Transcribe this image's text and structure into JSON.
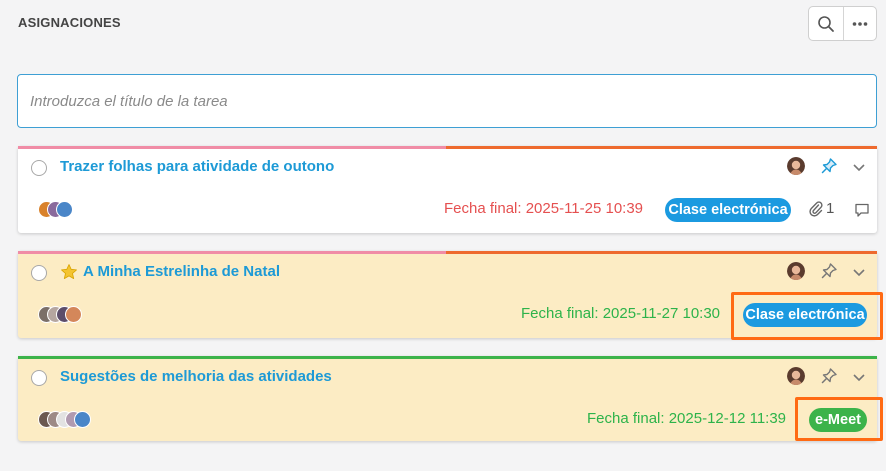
{
  "header": {
    "title": "ASIGNACIONES",
    "search_icon": "search-icon",
    "more_icon": "more-horizontal-icon"
  },
  "task_input": {
    "placeholder": "Introduzca el título de la tarea",
    "value": ""
  },
  "colors": {
    "link_blue": "#1d9ad6",
    "due_red": "#e55050",
    "due_green": "#2db34a",
    "badge_blue": "#1b9ae0",
    "badge_green": "#3cb34a",
    "card_yellow": "#fcecc4",
    "highlight_orange": "#ff6a13"
  },
  "tasks": [
    {
      "title": "Trazer folhas para atividade de outono",
      "due": "Fecha final: 2025-11-25 10:39",
      "badge": "Clase electrónica",
      "attachments": "1",
      "starred": false
    },
    {
      "title": "A Minha Estrelinha de Natal",
      "due": "Fecha final: 2025-11-27 10:30",
      "badge": "Clase electrónica",
      "starred": true
    },
    {
      "title": "Sugestões de melhoria das atividades",
      "due": "Fecha final: 2025-12-12 11:39",
      "badge": "e-Meet",
      "starred": false
    }
  ]
}
